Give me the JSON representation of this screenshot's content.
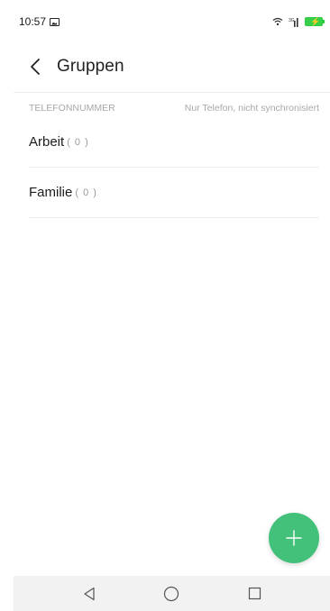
{
  "status_bar": {
    "time": "10:57",
    "icons": [
      "gallery-icon",
      "wifi-icon",
      "signal-icon",
      "battery-icon"
    ],
    "battery_color": "#36d04a"
  },
  "header": {
    "back_icon": "chevron-left-icon",
    "title": "Gruppen"
  },
  "section": {
    "label": "TELEFONNUMMER",
    "note": "Nur Telefon, nicht synchronisiert"
  },
  "groups": [
    {
      "name": "Arbeit",
      "count": "( 0 )"
    },
    {
      "name": "Familie",
      "count": "( 0 )"
    }
  ],
  "fab": {
    "icon": "plus-icon",
    "color": "#43c17b"
  },
  "nav_bar": {
    "icons": [
      "back-triangle-icon",
      "home-circle-icon",
      "recents-square-icon"
    ]
  }
}
